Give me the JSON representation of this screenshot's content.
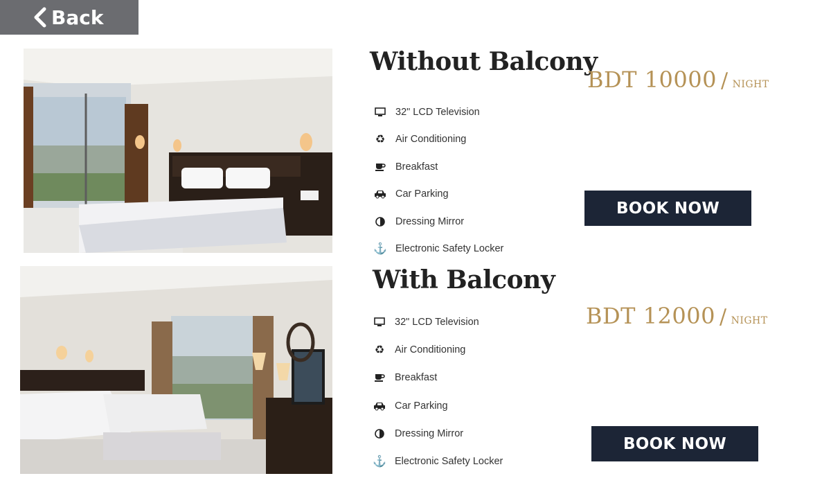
{
  "nav": {
    "back_label": "Back"
  },
  "rooms": [
    {
      "title": "Without Balcony",
      "price": {
        "amount": "BDT 10000",
        "unit": "Night"
      },
      "book_label": "BOOK NOW",
      "amenities": [
        {
          "icon": "tv-icon",
          "label": "32\" LCD Television"
        },
        {
          "icon": "recycle-icon",
          "label": "Air Conditioning"
        },
        {
          "icon": "coffee-icon",
          "label": "Breakfast"
        },
        {
          "icon": "car-icon",
          "label": "Car Parking"
        },
        {
          "icon": "contrast-icon",
          "label": "Dressing Mirror"
        },
        {
          "icon": "anchor-icon",
          "label": "Electronic Safety Locker"
        }
      ]
    },
    {
      "title": "With Balcony",
      "price": {
        "amount": "BDT 12000",
        "unit": "Night"
      },
      "book_label": "BOOK NOW",
      "amenities": [
        {
          "icon": "tv-icon",
          "label": "32\" LCD Television"
        },
        {
          "icon": "recycle-icon",
          "label": "Air Conditioning"
        },
        {
          "icon": "coffee-icon",
          "label": "Breakfast"
        },
        {
          "icon": "car-icon",
          "label": "Car Parking"
        },
        {
          "icon": "contrast-icon",
          "label": "Dressing Mirror"
        },
        {
          "icon": "anchor-icon",
          "label": "Electronic Safety Locker"
        }
      ]
    }
  ]
}
